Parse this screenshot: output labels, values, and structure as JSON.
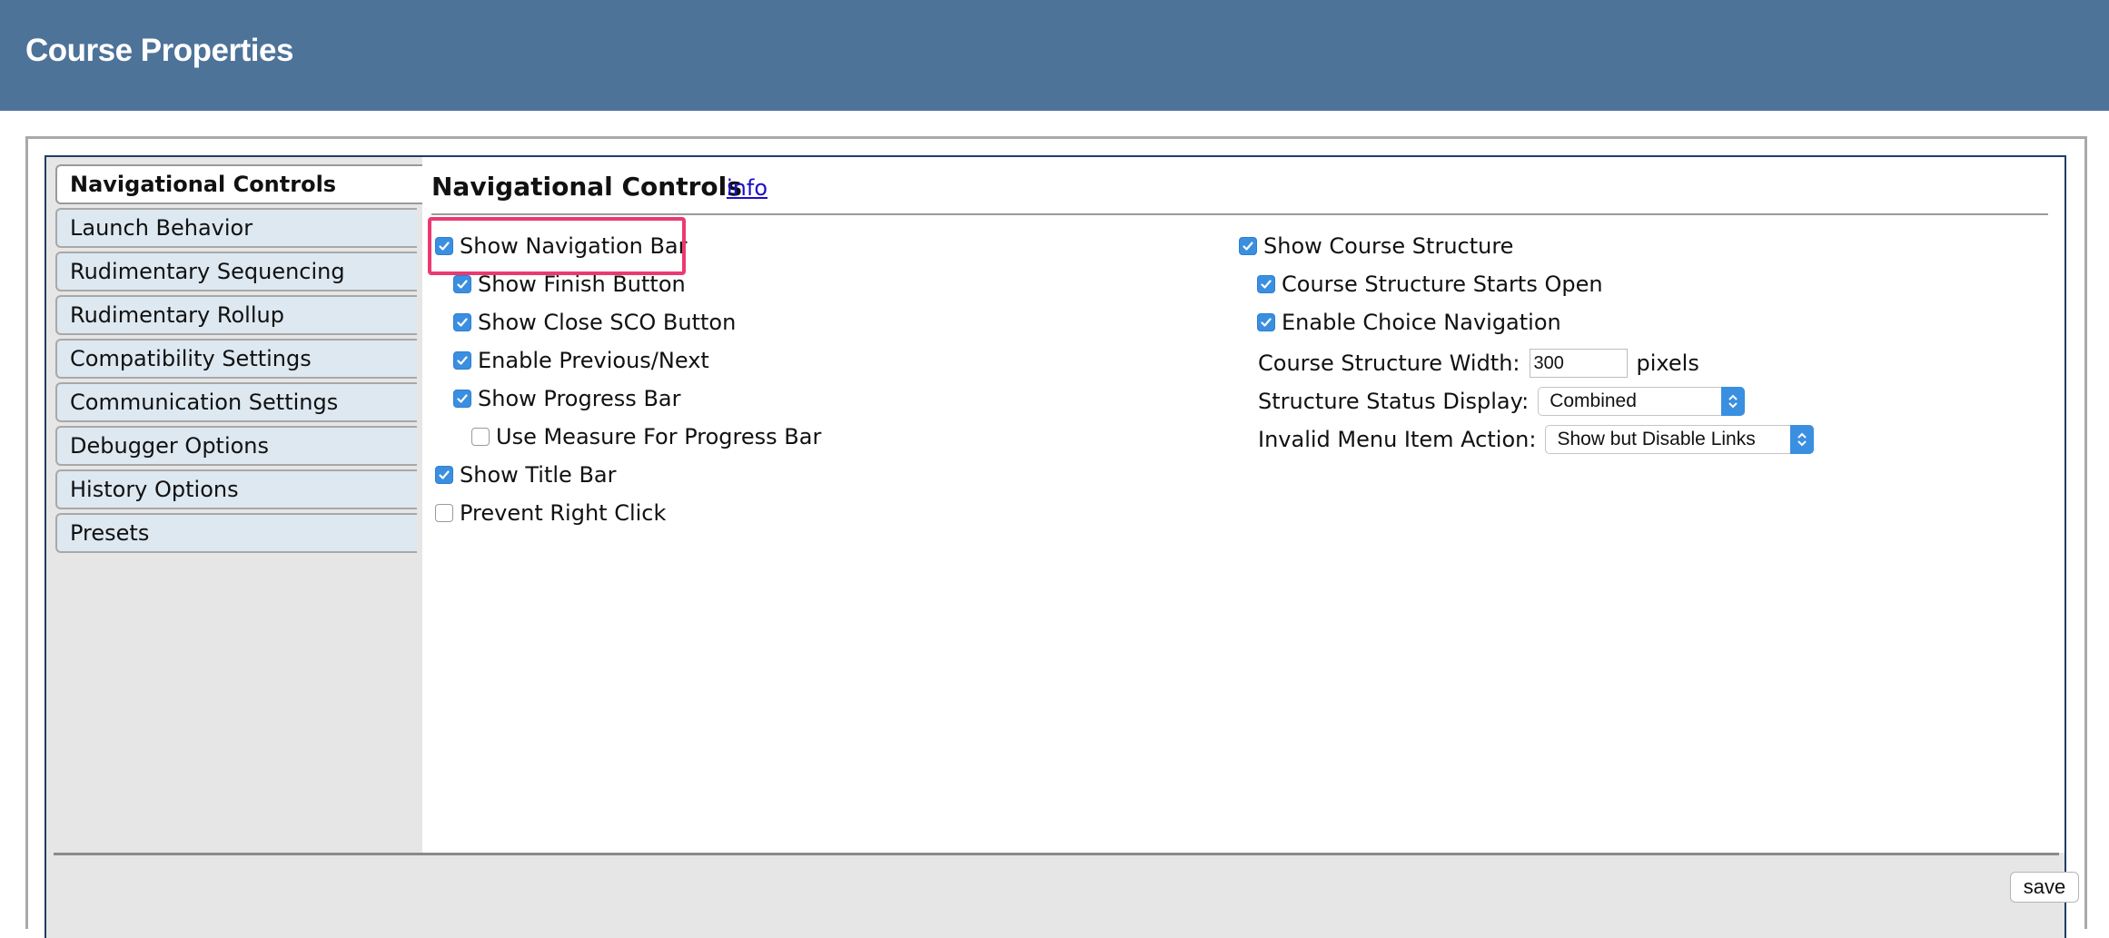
{
  "header": {
    "title": "Course Properties"
  },
  "tabs": [
    {
      "label": "Navigational Controls",
      "active": true
    },
    {
      "label": "Launch Behavior",
      "active": false
    },
    {
      "label": "Rudimentary Sequencing",
      "active": false
    },
    {
      "label": "Rudimentary Rollup",
      "active": false
    },
    {
      "label": "Compatibility Settings",
      "active": false
    },
    {
      "label": "Communication Settings",
      "active": false
    },
    {
      "label": "Debugger Options",
      "active": false
    },
    {
      "label": "History Options",
      "active": false
    },
    {
      "label": "Presets",
      "active": false
    }
  ],
  "panel": {
    "title": "Navigational Controls",
    "info_link": "info",
    "left_options": [
      {
        "label": "Show Navigation Bar",
        "checked": true
      },
      {
        "label": "Show Finish Button",
        "checked": true
      },
      {
        "label": "Show Close SCO Button",
        "checked": true
      },
      {
        "label": "Enable Previous/Next",
        "checked": true
      },
      {
        "label": "Show Progress Bar",
        "checked": true
      },
      {
        "label": "Use Measure For Progress Bar",
        "checked": false
      },
      {
        "label": "Show Title Bar",
        "checked": true
      },
      {
        "label": "Prevent Right Click",
        "checked": false
      }
    ],
    "right_options": [
      {
        "label": "Show Course Structure",
        "checked": true
      },
      {
        "label": "Course Structure Starts Open",
        "checked": true
      },
      {
        "label": "Enable Choice Navigation",
        "checked": true
      }
    ],
    "structure_width": {
      "label": "Course Structure Width:",
      "value": "300",
      "unit": "pixels"
    },
    "status_display": {
      "label": "Structure Status Display:",
      "selected": "Combined"
    },
    "invalid_menu_action": {
      "label": "Invalid Menu Item Action:",
      "selected": "Show but Disable Links"
    }
  },
  "footer": {
    "save_label": "save"
  },
  "colors": {
    "header_bg": "#4e7399",
    "highlight_border": "#ea3a71",
    "checkbox_checked": "#3a8fe0",
    "link": "#1a0dcc"
  }
}
